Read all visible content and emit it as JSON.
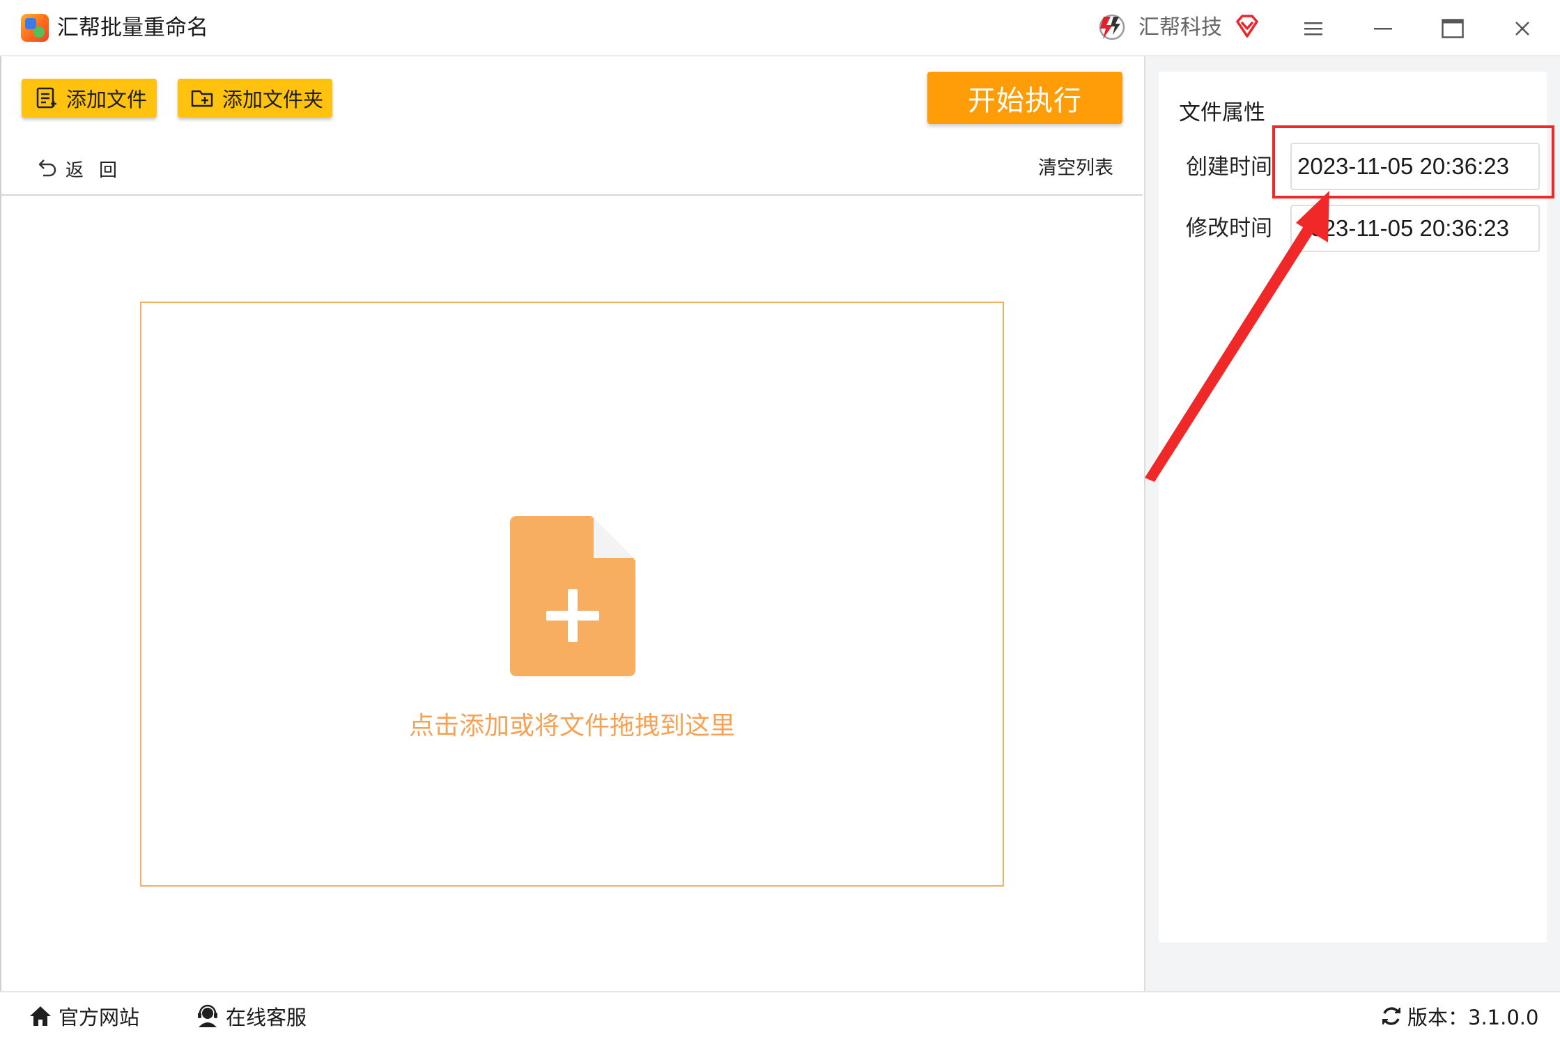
{
  "app": {
    "title": "汇帮批量重命名",
    "brand": "汇帮科技"
  },
  "window_controls": [
    "menu-icon",
    "minimize-icon",
    "maximize-icon",
    "close-icon"
  ],
  "toolbar": {
    "add_file_label": "添加文件",
    "add_folder_label": "添加文件夹",
    "start_label": "开始执行",
    "back_label": "返回",
    "clear_list_label": "清空列表"
  },
  "drop_zone": {
    "hint": "点击添加或将文件拖拽到这里",
    "icon": "file-add-icon"
  },
  "properties": {
    "title": "文件属性",
    "created_label": "创建时间",
    "created_value": "2023-11-05 20:36:23",
    "modified_label": "修改时间",
    "modified_value": "2023-11-05 20:36:23"
  },
  "footer": {
    "site_label": "官方网站",
    "service_label": "在线客服",
    "version_label": "版本：3.1.0.0"
  },
  "colors": {
    "toolbar_button": "#ffc20e",
    "start_button": "#ff9d08",
    "drop_accent": "#f9ad60",
    "annotation_red": "#f02828"
  }
}
